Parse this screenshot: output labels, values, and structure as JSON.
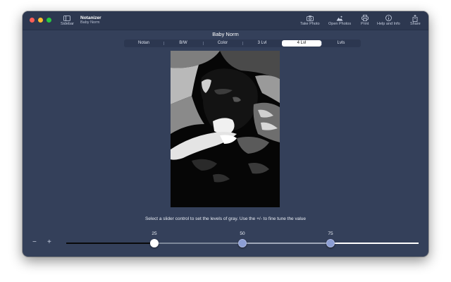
{
  "app": {
    "name": "Notanizer",
    "document": "Baby Norm"
  },
  "toolbar": {
    "sidebar_label": "Sidebar",
    "take_photo_label": "Take Photo",
    "open_photos_label": "Open Photos",
    "print_label": "Print",
    "help_label": "Help and Info",
    "share_label": "Share"
  },
  "main": {
    "title": "Baby Norm",
    "tabs": [
      {
        "label": "Notan"
      },
      {
        "label": "B/W"
      },
      {
        "label": "Color"
      },
      {
        "label": "3 Lvl"
      },
      {
        "label": "4 Lvl"
      },
      {
        "label": "Lvls"
      }
    ],
    "selected_tab": "4 Lvl",
    "instruction": "Select a slider control to set the levels of gray. Use the +/- to fine tune the value"
  },
  "levels": {
    "minus_label": "−",
    "plus_label": "+",
    "thumbs": [
      {
        "value": "25"
      },
      {
        "value": "50"
      },
      {
        "value": "75"
      }
    ],
    "colors": {
      "dark_segment": "#0a0a0a",
      "mid_segment": "#7d8799",
      "light_segment": "#ffffff",
      "thumb_selected": "#ffffff",
      "thumb_normal": "#8c9ed4"
    }
  }
}
